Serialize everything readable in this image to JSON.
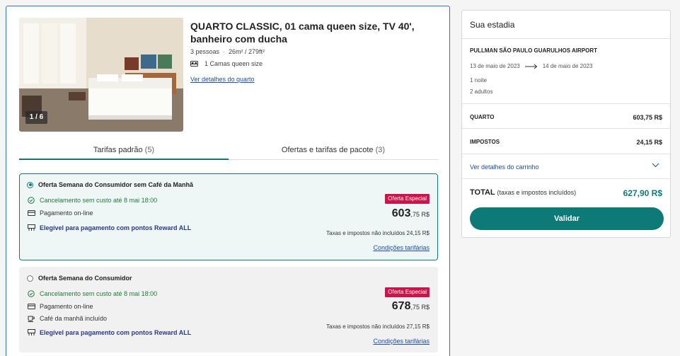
{
  "room": {
    "title": "QUARTO CLASSIC, 01 cama queen size, TV 40', banheiro com ducha",
    "guests": "3 pessoas",
    "size": "26m² / 279ft²",
    "bed": "1 Camas queen size",
    "details_link": "Ver detalhes do quarto",
    "photo_counter": "1 / 6"
  },
  "tabs": [
    {
      "label": "Tarifas padrão",
      "count": "(5)"
    },
    {
      "label": "Ofertas e tarifas de pacote",
      "count": "(3)"
    }
  ],
  "offers": [
    {
      "title": "Oferta Semana do Consumidor sem Café da Manhã",
      "cancellation": "Cancelamento sem custo até 8 mai 18:00",
      "payment": "Pagamento on-line",
      "reward": "Elegível para pagamento com pontos Reward ALL",
      "badge": "Oferta Especial",
      "price_int": "603",
      "price_dec": ",75 R$",
      "taxes": "Taxas e impostos não incluídos 24,15 R$",
      "conditions": "Condições tarifárias"
    },
    {
      "title": "Oferta Semana do Consumidor",
      "cancellation": "Cancelamento sem custo até 8 mai 18:00",
      "payment": "Pagamento on-line",
      "breakfast": "Café da manhã incluído",
      "reward": "Elegível para pagamento com pontos Reward ALL",
      "badge": "Oferta Especial",
      "price_int": "678",
      "price_dec": ",75 R$",
      "taxes": "Taxas e impostos não incluídos 27,15 R$",
      "conditions": "Condições tarifárias"
    }
  ],
  "summary": {
    "header": "Sua estadia",
    "hotel": "PULLMAN SÃO PAULO GUARULHOS AIRPORT",
    "checkin": "13 de maio de 2023",
    "checkout": "14 de maio de 2023",
    "nights": "1 noite",
    "adults": "2 adultos",
    "room_label": "QUARTO",
    "room_value": "603,75 R$",
    "taxes_label": "IMPOSTOS",
    "taxes_value": "24,15 R$",
    "cart_link": "Ver detalhes do carrinho",
    "total_label": "TOTAL",
    "total_note": "(taxas e impostos incluídos)",
    "total_value": "627,90 R$",
    "validate": "Validar"
  },
  "colors": {
    "accent": "#0e7a78",
    "badge": "#c8154a",
    "link": "#1d4fa6",
    "card_border": "#2f6fd6"
  }
}
